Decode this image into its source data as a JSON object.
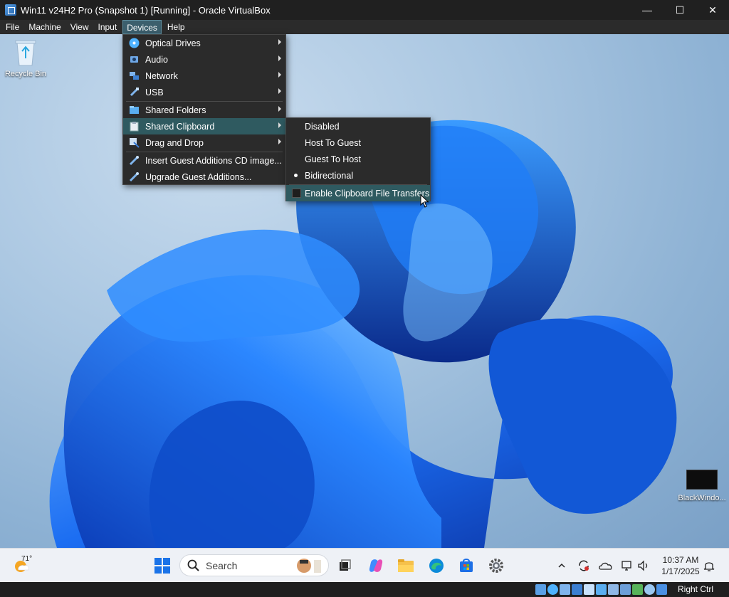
{
  "window": {
    "title": "Win11 v24H2 Pro (Snapshot 1) [Running] - Oracle VirtualBox",
    "controls": {
      "minimize": "—",
      "maximize": "☐",
      "close": "✕"
    }
  },
  "menubar": {
    "items": [
      "File",
      "Machine",
      "View",
      "Input",
      "Devices",
      "Help"
    ],
    "active": "Devices"
  },
  "desktop": {
    "icons": [
      {
        "label": "Recycle Bin",
        "icon": "recycle-bin-icon"
      },
      {
        "label": "BlackWindo...",
        "icon": "app-thumbnail"
      }
    ]
  },
  "devices_menu": {
    "items": [
      {
        "label": "Optical Drives",
        "icon": "optical-disc-icon",
        "submenu": true
      },
      {
        "label": "Audio",
        "icon": "audio-icon",
        "submenu": true
      },
      {
        "label": "Network",
        "icon": "network-icon",
        "submenu": true
      },
      {
        "label": "USB",
        "icon": "usb-icon",
        "submenu": true
      },
      {
        "label": "Shared Folders",
        "icon": "shared-folder-icon",
        "submenu": true
      },
      {
        "label": "Shared Clipboard",
        "icon": "clipboard-icon",
        "submenu": true,
        "highlighted": true
      },
      {
        "label": "Drag and Drop",
        "icon": "drag-drop-icon",
        "submenu": true
      },
      {
        "label": "Insert Guest Additions CD image...",
        "icon": "guest-additions-icon",
        "submenu": false
      },
      {
        "label": "Upgrade Guest Additions...",
        "icon": "upgrade-icon",
        "submenu": false
      }
    ]
  },
  "clipboard_submenu": {
    "items": [
      {
        "label": "Disabled",
        "selected": false
      },
      {
        "label": "Host To Guest",
        "selected": false
      },
      {
        "label": "Guest To Host",
        "selected": false
      },
      {
        "label": "Bidirectional",
        "selected": true
      }
    ],
    "checkbox_item": {
      "label": "Enable Clipboard File Transfers",
      "checked": false,
      "highlighted": true
    }
  },
  "taskbar": {
    "weather_temp": "71°",
    "search_label": "Search",
    "apps": [
      "start-icon",
      "search",
      "task-view-icon",
      "copilot-icon",
      "file-explorer-icon",
      "edge-icon",
      "store-icon",
      "settings-icon"
    ],
    "tray": [
      "chevron-up-icon",
      "sync-icon",
      "onedrive-icon",
      "network-icon",
      "volume-icon"
    ],
    "time": "10:37 AM",
    "date": "1/17/2025"
  },
  "statusbar": {
    "host_key": "Right Ctrl"
  },
  "colors": {
    "menu_bg": "#2b2b2b",
    "highlight": "#2f5a60",
    "accent_blue": "#1565e0"
  }
}
